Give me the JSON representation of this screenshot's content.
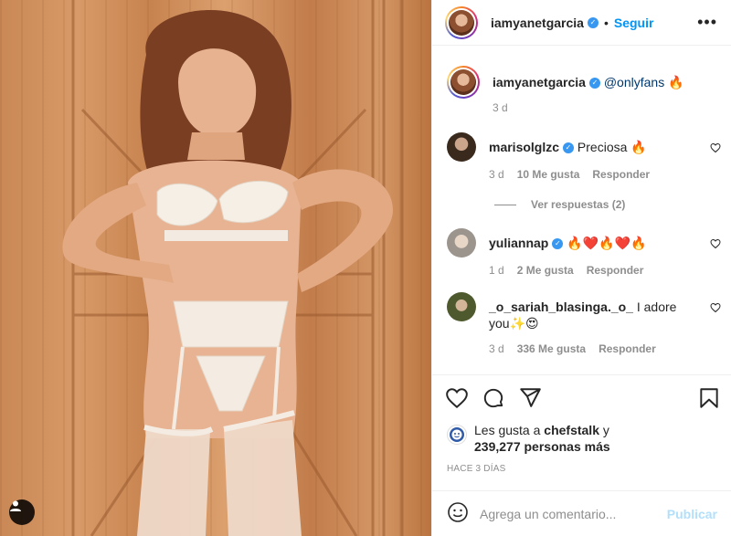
{
  "post": {
    "username": "iamyanetgarcia",
    "follow_label": "Seguir",
    "dot": "•",
    "more_label": "•••",
    "caption": {
      "username": "iamyanetgarcia",
      "mention": "@onlyfans",
      "emoji": "🔥",
      "time": "3 d"
    }
  },
  "comments": [
    {
      "username": "marisolglzc",
      "verified": true,
      "text": "Preciosa 🔥",
      "time": "3 d",
      "likes": "10 Me gusta",
      "reply": "Responder",
      "avatar_color": "#4a3a2c"
    },
    {
      "username": "yuliannap",
      "verified": true,
      "text": "🔥❤️🔥❤️🔥",
      "time": "1 d",
      "likes": "2 Me gusta",
      "reply": "Responder",
      "avatar_color": "#b9b3ad"
    },
    {
      "username": "_o_sariah_blasinga._o_",
      "verified": false,
      "text": "I adore",
      "text2": "you✨😍",
      "time": "3 d",
      "likes": "336 Me gusta",
      "reply": "Responder",
      "avatar_color": "#5c6b3a"
    }
  ],
  "view_replies": "Ver respuestas (2)",
  "likes": {
    "prefix": "Les gusta a ",
    "user": "chefstalk",
    "suffix": " y",
    "count_text": "239,277 personas más"
  },
  "time_ago": "HACE 3 DÍAS",
  "add_comment": {
    "placeholder": "Agrega un comentario...",
    "publish": "Publicar"
  },
  "icons": {
    "like": "heart-icon",
    "comment": "comment-icon",
    "share": "share-icon",
    "save": "bookmark-icon",
    "emoji": "emoji-icon",
    "verified": "verified-badge-icon",
    "user_tag": "user-tag-icon"
  },
  "colors": {
    "link_blue": "#0095f6",
    "verified_blue": "#3897f0",
    "muted": "#8e8e8e",
    "publish_disabled": "#b2dffc"
  }
}
